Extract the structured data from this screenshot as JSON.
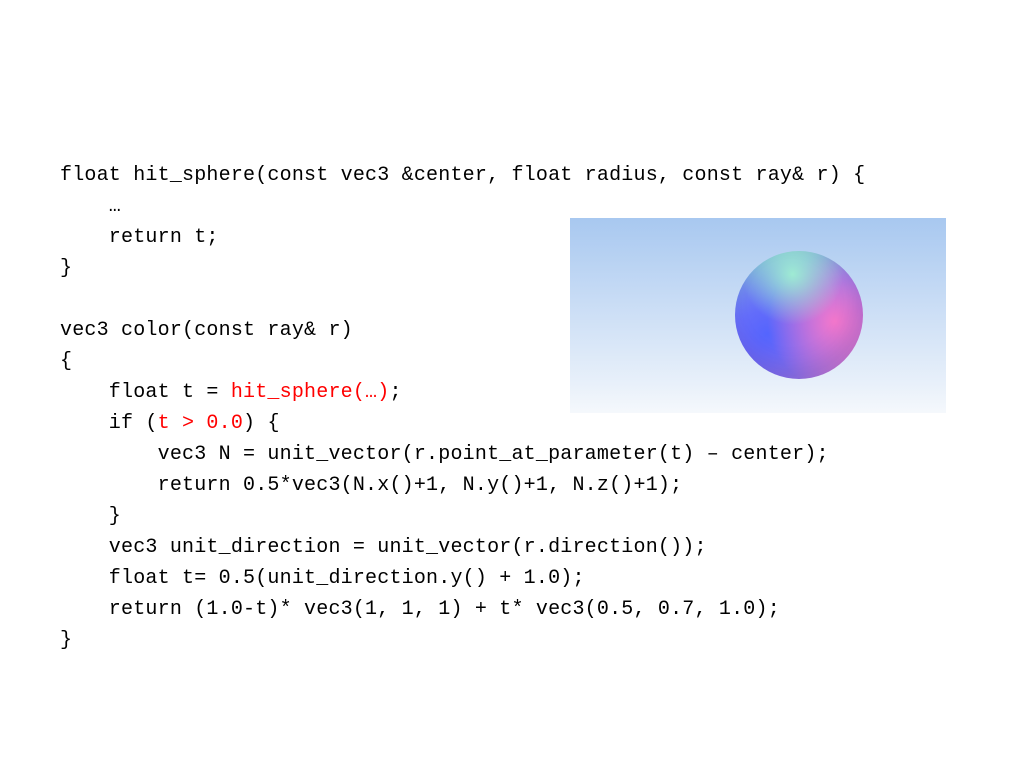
{
  "code": {
    "l01a": "float hit_sphere(const vec3 &center, float radius, const ray& r) {",
    "l02a": "    …",
    "l03a": "    return t;",
    "l04a": "}",
    "l05a": "",
    "l06a": "vec3 color(const ray& r)",
    "l07a": "{",
    "l08a": "    float t = ",
    "l08r": "hit_sphere(…)",
    "l08b": ";",
    "l09a": "    if (",
    "l09r": "t > 0.0",
    "l09b": ") {",
    "l10a": "        vec3 N = unit_vector(r.point_at_parameter(t) – center);",
    "l11a": "        return 0.5*vec3(N.x()+1, N.y()+1, N.z()+1);",
    "l12a": "    }",
    "l13a": "    vec3 unit_direction = unit_vector(r.direction());",
    "l14a": "    float t= 0.5(unit_direction.y() + 1.0);",
    "l15a": "    return (1.0-t)* vec3(1, 1, 1) + t* vec3(0.5, 0.7, 1.0);",
    "l16a": "}"
  }
}
